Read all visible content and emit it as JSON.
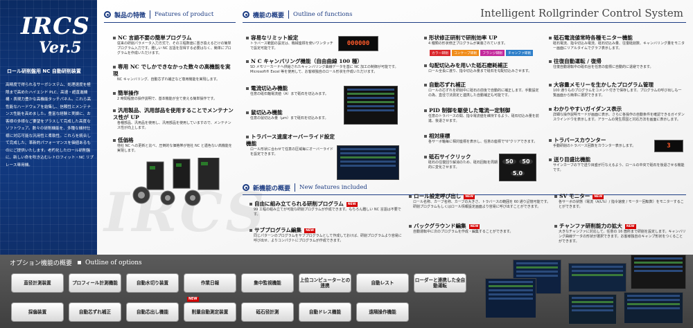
{
  "brand": {
    "logo_main": "IRCS",
    "logo_version": "Ver.5",
    "subtitle": "ロール研削盤用 NC 自動研削装置",
    "body": "高精度で得られるサーボシステム、処理速度を極限まで高めたハイエンド PLC、高速・超直進機構・表現力豊かな高機能タッチパネル。これら高性能なハードウェアを結集し、信頼性とメンテナンス性能を高めました。豊富な経験と実績に、お客様の多様なご要望をプラスして完成した高度なソフトウェア。数々の研削機能を、多種な機材仕様に対応可能な汎用性と柔軟性。これらを統合して完成した、革新的パフォーマンスを価値あるものにご提供いたします。老朽化したロール研削盤に、新しい命を吹き込むレトロフィット・NC リプレース専用機。",
    "watermark": "IRCS"
  },
  "tagline": "Intelligent Rollgrinder Control System",
  "sections": {
    "product": {
      "jp": "製品の特徴",
      "en": "Features of product"
    },
    "functions": {
      "jp": "機能の概要",
      "en": "Outline of functions"
    },
    "new": {
      "jp": "新機能の概要",
      "en": "New features included"
    },
    "options": {
      "jp": "オプション機能の概要",
      "en": "Outline of options"
    }
  },
  "product_features": [
    {
      "title": "NC 言語不要の簡単プログラム",
      "desc": "従来の研削パラメータ入力方式で、その工程数値に置き換えるだけの簡単プログラム入力です。難しい NC 言語を習得する必要はなく、簡単にプログラムを作成いただけます。"
    },
    {
      "title": "専用 NC でしかできなかった数々の高機能を実現",
      "desc": "NC キャンバリング、自動芯ずれ補正など専用機能を実現します。"
    },
    {
      "title": "簡単操作",
      "desc": "2 時間程度の操作説明で、基本機能が全て使える簡単操作です。"
    },
    {
      "title": "汎用製品、汎用部品を使用することでメンテナンス性が UP",
      "desc": "各種部品、汎用品を使用し、汎用部品を使用していますので、メンテナンス性が向上します。"
    },
    {
      "title": "低価格",
      "desc": "他社 NC への更新と比べ、圧倒的な価格帯が他社 NC と遜色ない高機能を実現します。"
    }
  ],
  "functions_col1": [
    {
      "title": "容易なリミット設定",
      "desc": "トラバース範囲の設定は、機械座標を使いワンタッチで設定可能です。"
    },
    {
      "title": "N C キャンバリング機能（自由曲線 100 種）",
      "desc": "SD メモリーカードへ供給されたキャンバリング曲線データを基に NC 加工の制御が可能です。Microsoft® Excel 等を使用して、お客様独自のロール形状を作成いただけます。"
    },
    {
      "title": "電流切込み機能",
      "desc": "任意の砥石軸電流値（A）まで砥石を切込みます。"
    },
    {
      "title": "鼠切込み機能",
      "desc": "任意の鼠切込み量（μm）まで砥石を切込みます。"
    },
    {
      "title": "トラバース速度オーバーライド設定機能",
      "desc": "ロール形状に合わせて任意の区域毎にオーバーライドを設定できます。"
    }
  ],
  "functions_col2": [
    {
      "title": "形状修正研削で研削効率 UP",
      "desc": "4 種類の形状修正プログラムが実装されています。"
    },
    {
      "title": "勾配切込みを用いた砥石磨耗補正",
      "desc": "ロール全長に渡り、指令切込み量まで砥石を勾配切込みさせます。"
    },
    {
      "title": "自動芯ずれ補正",
      "desc": "ロールの芯ずれを研削中に砥石の前後で自動的に補正します。手動設定の為、直径寸法測定と連携した自動補正も可能です。"
    },
    {
      "title": "PID 制御を駆使した電流一定制御",
      "desc": "任意のトラバースの間、指令電流値を維持するよう、砥石切込み量を前進、後退させます。"
    },
    {
      "title": "相対座標",
      "desc": "各サーボ軸毎に相対座標を表示し、任意の座標で\"0\"クリアできます。"
    },
    {
      "title": "砥石サイクリック",
      "desc": "砥石の往復回り解消のため、砥石回転を周期的に変化させます。"
    }
  ],
  "shape_chips": [
    {
      "label": "カラー研削",
      "color": "#d9262b"
    },
    {
      "label": "コンケーブ研削",
      "color": "#f08c1a"
    },
    {
      "label": "フランジ研削",
      "color": "#c42a9c"
    },
    {
      "label": "チャンファ研削",
      "color": "#2f7fc9"
    }
  ],
  "functions_col3": [
    {
      "title": "砥石電流値常時各種モニター機能",
      "desc": "砥石電流、指令切込み電流、砥石切込み量、往復砥削数、キャンバリング量をモニター画面にリアルタイムでグラフ表示します。"
    },
    {
      "title": "往復自動運転 / 復帰",
      "desc": "往復自動運転中の砥石台を任意の座標に自動的に退避できます。"
    },
    {
      "title": "大容量メモリーを生かしたプログラム管理",
      "desc": "100 通りものプログラムをコメント付きで保存します。プログラムの呼び出しも一覧画面から簡単に選択できます。"
    },
    {
      "title": "わかりやすいガイダンス表示",
      "desc": "詳細な操作説明モードが画面に表示、さらに各操作の自動条件を確認できるガイダンスウインドウを表示します。アラームの発生原因と対応方法を画面に表示します。"
    },
    {
      "title": "トラバースカウンター",
      "desc": "手動研削のトラバース回数をカウンター表示します。"
    },
    {
      "title": "送り目盛比機能",
      "desc": "サインカーブの下で送り目盛が行なえるよう、ロールの中央で砥石を後退させる機能です。"
    }
  ],
  "new_features": [
    {
      "title": "自由に組み立てられる研削プログラム",
      "badge": "NEW",
      "desc": "99 工程の組み立てが可能な研削プログラムが作成できます。もちろん難しい NC 言語は不要です。"
    },
    {
      "title": "サブプログラム編集",
      "badge": "NEW",
      "desc": "同じパターンのプログラムをサブプログラムとして作成しておけば、研削プログラムより容易に呼び出せ、よりコンパクトにプログラムが作成できます。"
    },
    {
      "title": "ロール設定呼び出し",
      "badge": "NEW",
      "desc": "ロール名称、カーブ名称、カーブの大きさ、トラバースの範囲を 60 通り記憶可能です。研削プログラムもしくはロール情報設定画面より容易に呼び出すことができます。"
    },
    {
      "title": "バックグラウンド編集",
      "badge": "NEW",
      "desc": "自動運転中に次のプログラムを作成・編集することができます。"
    },
    {
      "title": "SV モニター",
      "badge": "NEW",
      "desc": "各サーボの状態（電流（A/L%）/ 指令速度 / モーター回転数）をモニターすることができます。"
    },
    {
      "title": "チャンファ研削能力の拡大",
      "badge": "NEW",
      "desc": "大きなチャンファに対応して、任意の 16 箇所まで研削を設定します。キャンバリング曲線データの形状が選択できます。お客様独自のキャンプ形状をつくることができます。"
    }
  ],
  "lcd_values": {
    "top": "000000",
    "trav": "3",
    "dial_1": "50",
    "dial_2": "50",
    "dial_3": "5.0"
  },
  "options": {
    "row1": [
      "直径計測装置",
      "プロフィール計測機能",
      "自動水切り装置",
      "作業日報",
      "集中監視機能",
      "上位コンピューターとの連携",
      "自動レスト",
      "ローダーと連携した全自動運転"
    ],
    "row2": [
      "採偏装置",
      "自動芯ずれ補正",
      "自動芯出し機能",
      "削量自動測定装置",
      "砥石径計測",
      "自動ドレス機能",
      "遠隔操作機能"
    ],
    "new_badge": "NEW"
  },
  "colors": {
    "navy": "#1b3b82",
    "accent_red": "#d40000",
    "band": "#4a4a4a"
  }
}
